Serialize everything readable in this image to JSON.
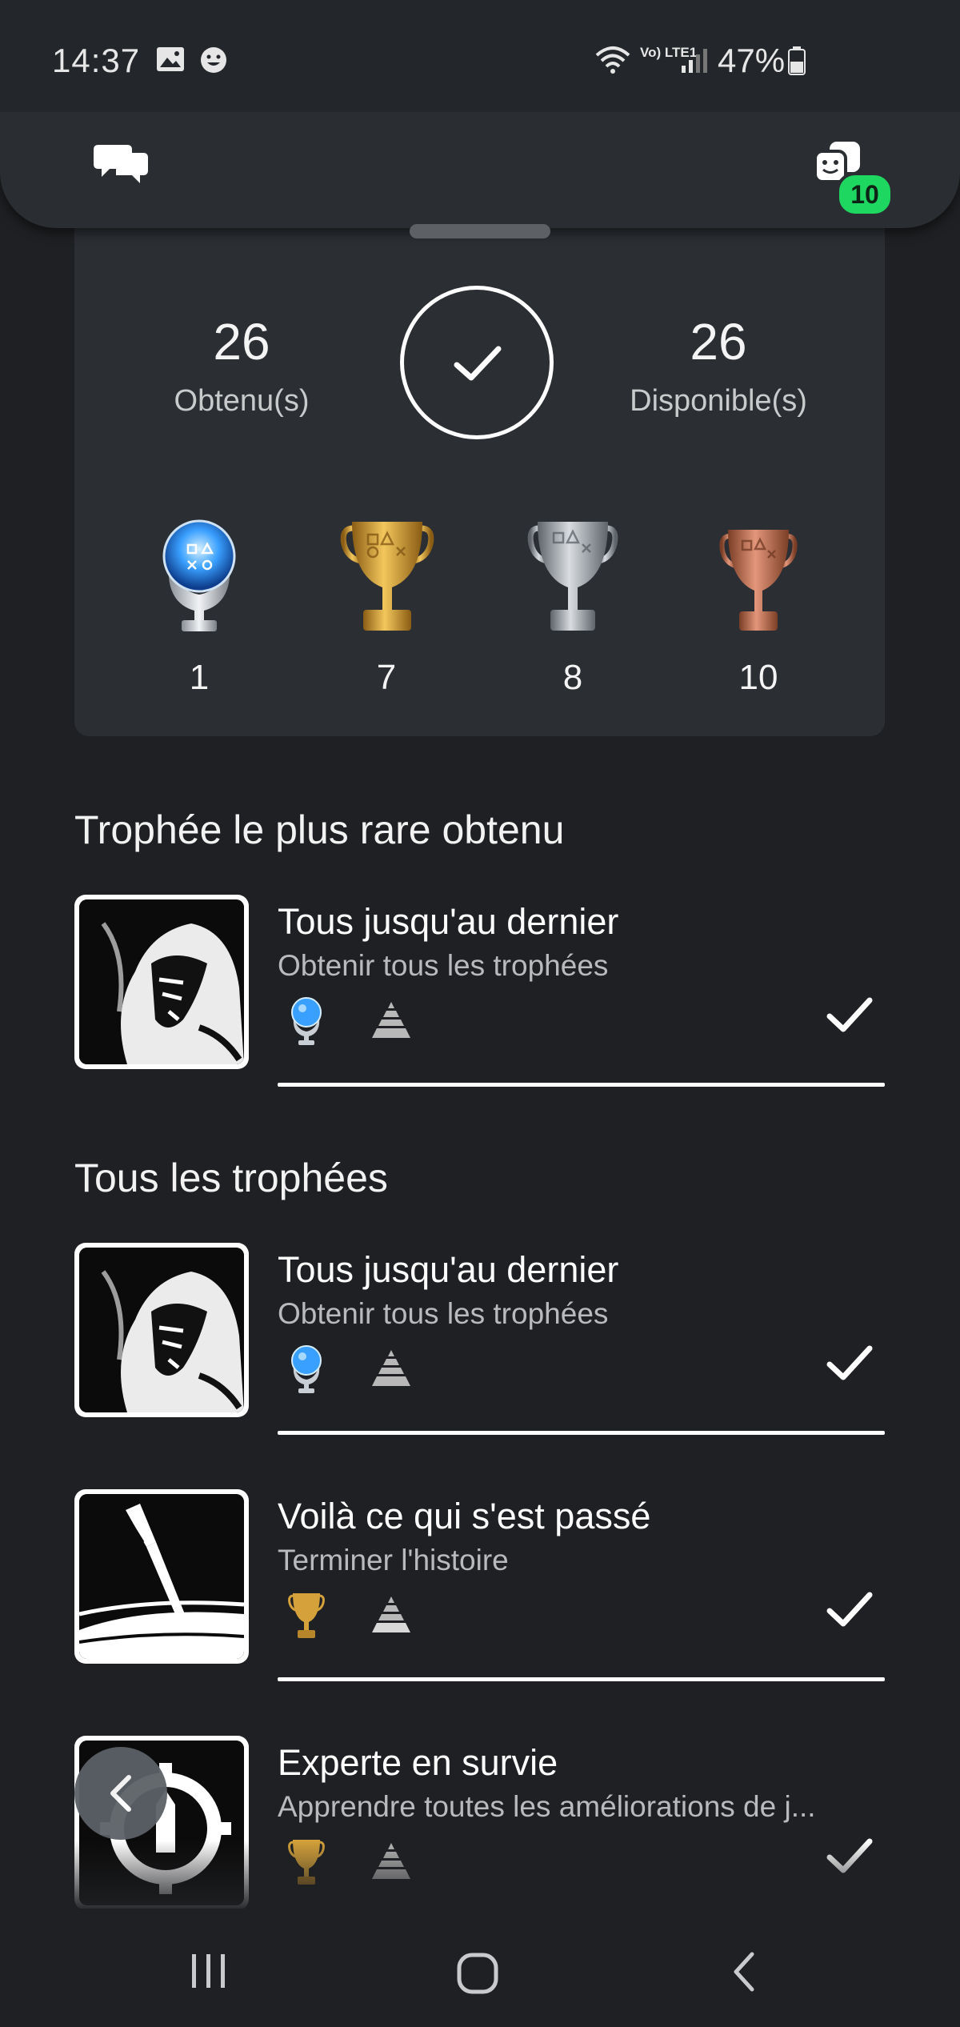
{
  "status_bar": {
    "time": "14:37",
    "battery": "47%",
    "network": "Vo) LTE1"
  },
  "header": {
    "notifications_badge": "10"
  },
  "summary": {
    "earned_count": "26",
    "earned_label": "Obtenu(s)",
    "available_count": "26",
    "available_label": "Disponible(s)",
    "trophies": {
      "platinum": "1",
      "gold": "7",
      "silver": "8",
      "bronze": "10"
    }
  },
  "rarest": {
    "section_title": "Trophée le plus rare obtenu",
    "item": {
      "title": "Tous jusqu'au dernier",
      "description": "Obtenir tous les trophées",
      "type": "platinum"
    }
  },
  "all_trophies": {
    "section_title": "Tous les trophées",
    "items": [
      {
        "title": "Tous jusqu'au dernier",
        "description": "Obtenir tous les trophées",
        "type": "platinum"
      },
      {
        "title": "Voilà ce qui s'est passé",
        "description": "Terminer l'histoire",
        "type": "gold"
      },
      {
        "title": "Experte en survie",
        "description": "Apprendre toutes les améliorations de j...",
        "type": "gold"
      }
    ]
  },
  "colors": {
    "background": "#1f2023",
    "card": "#2b2e33",
    "badge": "#1ed760",
    "gold": "#c8962e",
    "platinum": "#4aa8ff"
  }
}
